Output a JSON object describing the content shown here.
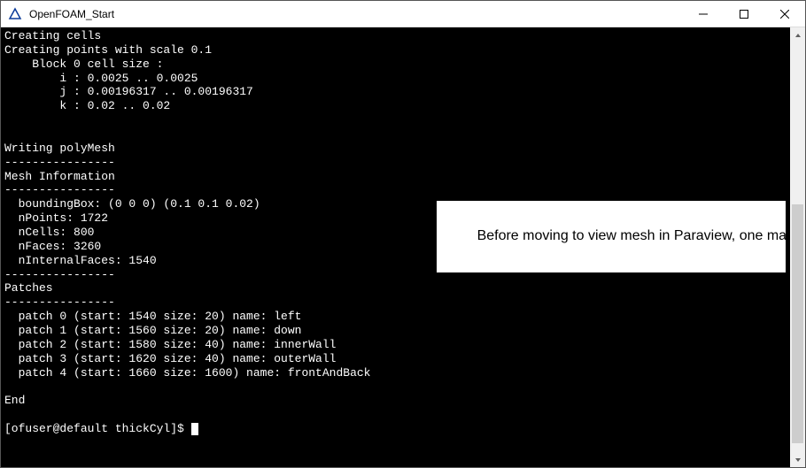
{
  "window": {
    "title": "OpenFOAM_Start"
  },
  "terminal": {
    "lines": {
      "l1": "Creating cells",
      "l2": "Creating points with scale 0.1",
      "l3": "    Block 0 cell size :",
      "l4": "        i : 0.0025 .. 0.0025",
      "l5": "        j : 0.00196317 .. 0.00196317",
      "l6": "        k : 0.02 .. 0.02",
      "l7": "",
      "l8": "",
      "l9": "Writing polyMesh",
      "l10": "----------------",
      "l11": "Mesh Information",
      "l12": "----------------",
      "l13": "  boundingBox: (0 0 0) (0.1 0.1 0.02)",
      "l14": "  nPoints: 1722",
      "l15": "  nCells: 800",
      "l16": "  nFaces: 3260",
      "l17": "  nInternalFaces: 1540",
      "l18": "----------------",
      "l19": "Patches",
      "l20": "----------------",
      "l21": "  patch 0 (start: 1540 size: 20) name: left",
      "l22": "  patch 1 (start: 1560 size: 20) name: down",
      "l23": "  patch 2 (start: 1580 size: 40) name: innerWall",
      "l24": "  patch 3 (start: 1620 size: 40) name: outerWall",
      "l25": "  patch 4 (start: 1660 size: 1600) name: frontAndBack",
      "l26": "",
      "l27": "End",
      "l28": ""
    },
    "prompt": "[ofuser@default thickCyl]$ "
  },
  "annotation": {
    "text": "Before moving to view mesh in Paraview, one may look for any warning   or   error message. Yet, remember that the absence of any warning or error does not mean the mesh generated would be as you expected!"
  }
}
